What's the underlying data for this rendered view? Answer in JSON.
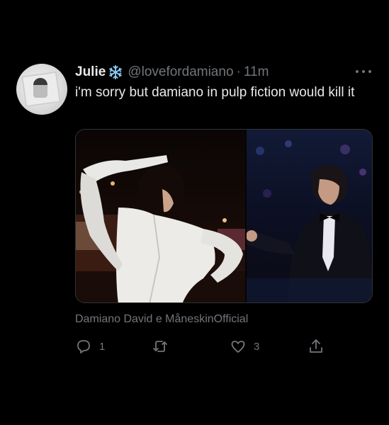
{
  "tweet": {
    "author_name": "Julie",
    "author_emoji": "snowflake-icon",
    "handle": "@lovefordamiano",
    "separator": "·",
    "time": "11m",
    "text": "i'm sorry but damiano in pulp fiction would kill it",
    "caption": "Damiano David e MåneskinOfficial",
    "replies": "1",
    "retweets": "",
    "likes": "3"
  },
  "colors": {
    "background": "#000000",
    "text_primary": "#e7e9ea",
    "text_secondary": "#71767b",
    "snowflake": "#8ecdf5"
  }
}
